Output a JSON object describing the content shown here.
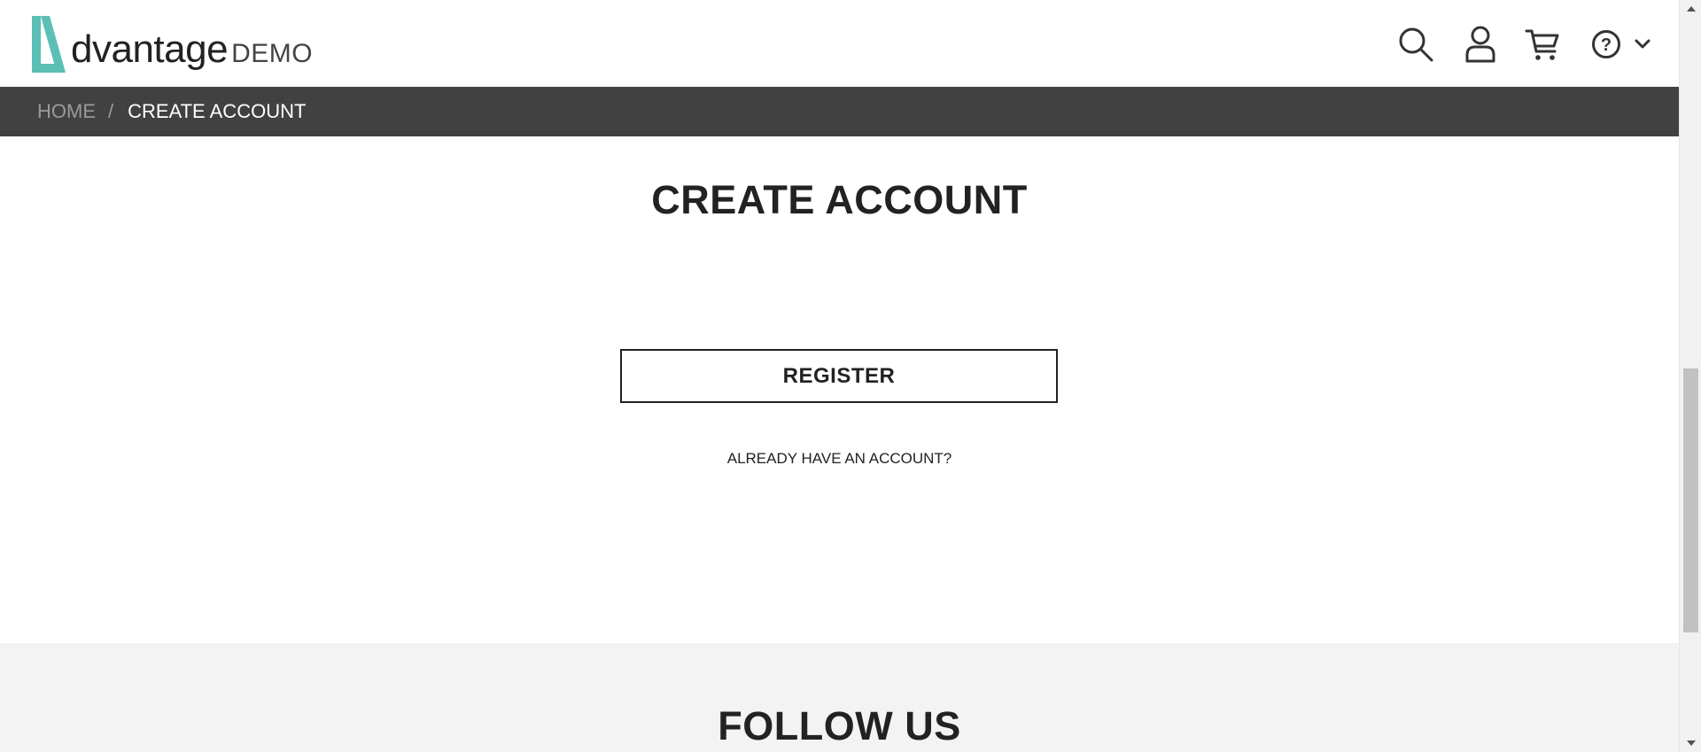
{
  "header": {
    "logo": {
      "text": "dvantage",
      "suffix": "DEMO",
      "accent_color": "#5bbfb5"
    },
    "icons": [
      {
        "name": "search-icon"
      },
      {
        "name": "user-icon"
      },
      {
        "name": "cart-icon"
      },
      {
        "name": "help-icon"
      },
      {
        "name": "chevron-down-icon"
      }
    ]
  },
  "breadcrumb": {
    "home_label": "HOME",
    "separator": "/",
    "current_label": "CREATE ACCOUNT",
    "bar_color": "#414141"
  },
  "main": {
    "title": "CREATE ACCOUNT",
    "register_label": "REGISTER",
    "already_label": "ALREADY HAVE AN ACCOUNT?"
  },
  "footer": {
    "follow_title": "FOLLOW US",
    "background_color": "#f3f3f3"
  }
}
